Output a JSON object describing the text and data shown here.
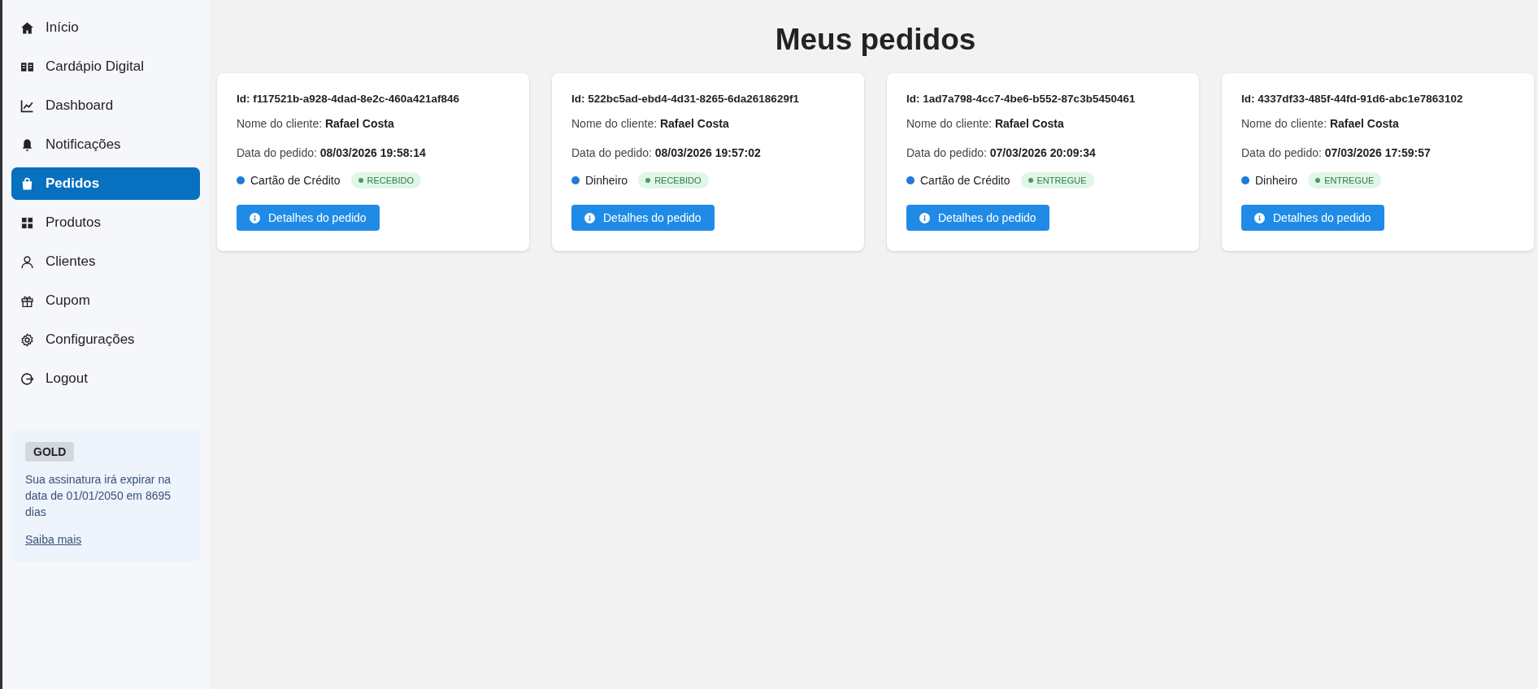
{
  "sidebar": {
    "items": [
      {
        "label": "Início",
        "kind": "home",
        "selected": false
      },
      {
        "label": "Cardápio Digital",
        "kind": "book",
        "selected": false
      },
      {
        "label": "Dashboard",
        "kind": "chart",
        "selected": false
      },
      {
        "label": "Notificações",
        "kind": "bell",
        "selected": false
      },
      {
        "label": "Pedidos",
        "kind": "bag",
        "selected": true
      },
      {
        "label": "Produtos",
        "kind": "grid",
        "selected": false
      },
      {
        "label": "Clientes",
        "kind": "user",
        "selected": false
      },
      {
        "label": "Cupom",
        "kind": "gift",
        "selected": false
      },
      {
        "label": "Configurações",
        "kind": "gear",
        "selected": false
      },
      {
        "label": "Logout",
        "kind": "logout",
        "selected": false
      }
    ],
    "plan": {
      "badge": "GOLD",
      "text": "Sua assinatura irá expirar na data de 01/01/2050 em 8695 dias",
      "link": "Saiba mais"
    }
  },
  "title": "Meus pedidos",
  "orders": [
    {
      "id": "Id: f117521b-a928-4dad-8e2c-460a421af846",
      "client": "Nome do cliente: **Rafael Costa**",
      "date": "Data do pedido: **08/03/2026 19:58:14**",
      "payment": "Cartão de Crédito",
      "status": "RECEBIDO",
      "button": "Detalhes do pedido"
    },
    {
      "id": "Id: 522bc5ad-ebd4-4d31-8265-6da2618629f1",
      "client": "Nome do cliente: **Rafael Costa**",
      "date": "Data do pedido: **08/03/2026 19:57:02**",
      "payment": "Dinheiro",
      "status": "RECEBIDO",
      "button": "Detalhes do pedido"
    },
    {
      "id": "Id: 1ad7a798-4cc7-4be6-b552-87c3b5450461",
      "client": "Nome do cliente: **Rafael Costa**",
      "date": "Data do pedido: **07/03/2026 20:09:34**",
      "payment": "Cartão de Crédito",
      "status": "ENTREGUE",
      "button": "Detalhes do pedido"
    },
    {
      "id": "Id: 4337df33-485f-44fd-91d6-abc1e7863102",
      "client": "Nome do cliente: **Rafael Costa**",
      "date": "Data do pedido: **07/03/2026 17:59:57**",
      "payment": "Dinheiro",
      "status": "ENTREGUE",
      "button": "Detalhes do pedido"
    }
  ]
}
